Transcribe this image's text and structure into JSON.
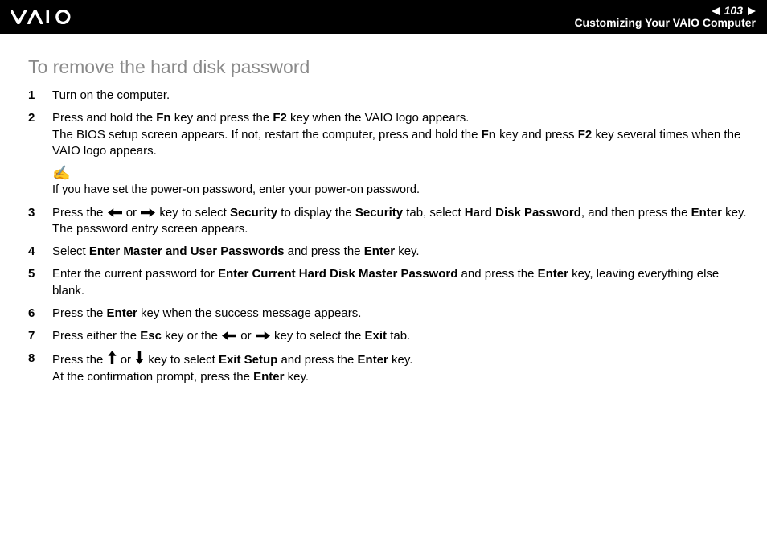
{
  "header": {
    "page_number": "103",
    "section": "Customizing Your VAIO Computer"
  },
  "title": "To remove the hard disk password",
  "steps": {
    "s1": {
      "num": "1",
      "text": "Turn on the computer."
    },
    "s2": {
      "num": "2",
      "a": "Press and hold the ",
      "fn": "Fn",
      "b": " key and press the ",
      "f2": "F2",
      "c": " key when the VAIO logo appears.",
      "d": "The BIOS setup screen appears. If not, restart the computer, press and hold the ",
      "e": " key and press ",
      "f": " key several times when the VAIO logo appears."
    },
    "s3": {
      "num": "3",
      "a": "Press the ",
      "b": " or ",
      "c": " key to select ",
      "security": "Security",
      "d": " to display the ",
      "e": " tab, select ",
      "hdp": "Hard Disk Password",
      "f": ", and then press the ",
      "enter": "Enter",
      "g": " key.",
      "h": "The password entry screen appears."
    },
    "s4": {
      "num": "4",
      "a": "Select ",
      "emup": "Enter Master and User Passwords",
      "b": " and press the ",
      "enter": "Enter",
      "c": " key."
    },
    "s5": {
      "num": "5",
      "a": "Enter the current password for ",
      "echdmp": "Enter Current Hard Disk Master Password",
      "b": " and press the ",
      "enter": "Enter",
      "c": " key, leaving everything else blank."
    },
    "s6": {
      "num": "6",
      "a": "Press the ",
      "enter": "Enter",
      "b": " key when the success message appears."
    },
    "s7": {
      "num": "7",
      "a": "Press either the ",
      "esc": "Esc",
      "b": " key or the ",
      "c": " or ",
      "d": " key to select the ",
      "exit": "Exit",
      "e": " tab."
    },
    "s8": {
      "num": "8",
      "a": "Press the ",
      "b": " or ",
      "c": " key to select ",
      "exitsetup": "Exit Setup",
      "d": " and press the ",
      "enter": "Enter",
      "e": " key.",
      "f": "At the confirmation prompt, press the ",
      "g": " key."
    }
  },
  "note": {
    "text": "If you have set the power-on password, enter your power-on password."
  }
}
